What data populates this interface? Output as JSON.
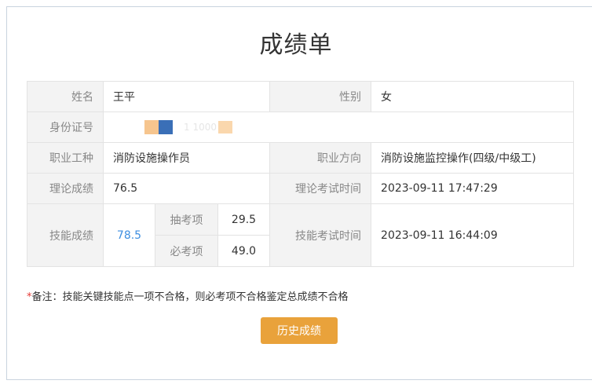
{
  "title": "成绩单",
  "rows": {
    "name": {
      "label": "姓名",
      "value": "王平"
    },
    "gender": {
      "label": "性别",
      "value": "女"
    },
    "id": {
      "label": "身份证号",
      "value_fragment": "　",
      "trailing_fragment": "1 1000"
    },
    "job": {
      "label": "职业工种",
      "value": "消防设施操作员"
    },
    "direction": {
      "label": "职业方向",
      "value": "消防设施监控操作(四级/中级工)"
    },
    "theory": {
      "label": "理论成绩",
      "value": "76.5"
    },
    "theory_time": {
      "label": "理论考试时间",
      "value": "2023-09-11 17:47:29"
    },
    "skill": {
      "label": "技能成绩",
      "value": "78.5",
      "sub1": {
        "label": "抽考项",
        "value": "29.5"
      },
      "sub2": {
        "label": "必考项",
        "value": "49.0"
      }
    },
    "skill_time": {
      "label": "技能考试时间",
      "value": "2023-09-11 16:44:09"
    }
  },
  "note": {
    "star": "*",
    "text": "备注：技能关键技能点一项不合格，则必考项不合格鉴定总成绩不合格"
  },
  "history_button": "历史成绩",
  "colors": {
    "accent": "#e9a23b",
    "link": "#3d8ee0",
    "required": "#e53935"
  }
}
